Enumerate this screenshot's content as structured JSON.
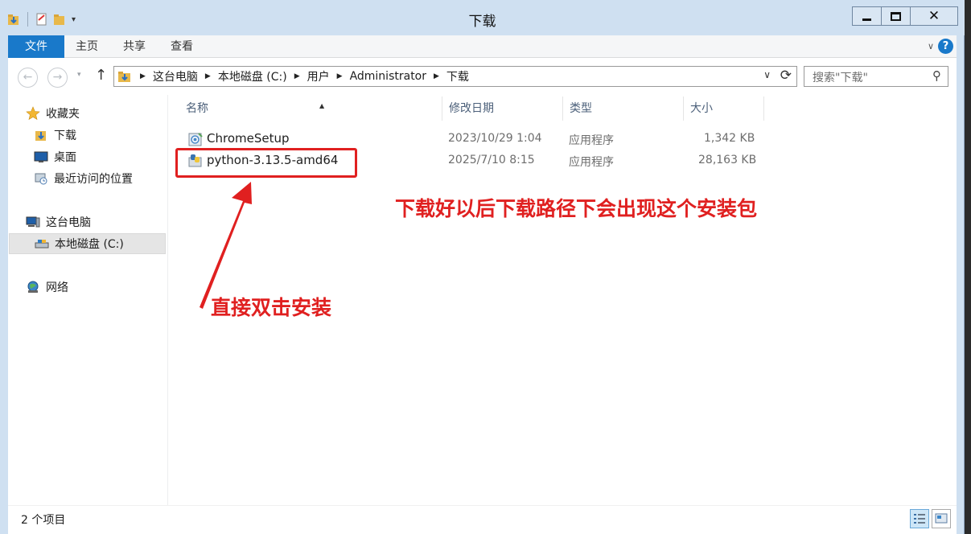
{
  "window": {
    "title": "下载",
    "minimize_icon": "minimize-icon",
    "maximize_icon": "maximize-icon",
    "close_label": "✕"
  },
  "ribbon": {
    "tabs": [
      "文件",
      "主页",
      "共享",
      "查看"
    ],
    "expand_glyph": "∨",
    "help_label": "?",
    "accent": "#1979ca"
  },
  "nav": {
    "back_glyph": "←",
    "forward_glyph": "→",
    "recent_glyph": "▾",
    "up_glyph": "↑",
    "breadcrumb": [
      "这台电脑",
      "本地磁盘 (C:)",
      "用户",
      "Administrator",
      "下载"
    ],
    "dropdown_glyph": "∨",
    "refresh_glyph": "⟳",
    "search_placeholder": "搜索\"下载\"",
    "search_icon": "⚲"
  },
  "sidebar": {
    "items": [
      {
        "label": "收藏夹",
        "icon": "star-icon"
      },
      {
        "label": "下载",
        "icon": "download-folder-icon"
      },
      {
        "label": "桌面",
        "icon": "desktop-icon"
      },
      {
        "label": "最近访问的位置",
        "icon": "recent-places-icon"
      },
      {
        "label": "这台电脑",
        "icon": "computer-icon"
      },
      {
        "label": "本地磁盘 (C:)",
        "icon": "drive-icon"
      },
      {
        "label": "网络",
        "icon": "network-icon"
      }
    ]
  },
  "columns": [
    "名称",
    "修改日期",
    "类型",
    "大小"
  ],
  "sort_glyph": "▲",
  "files": [
    {
      "name": "ChromeSetup",
      "date": "2023/10/29 1:04",
      "type": "应用程序",
      "size": "1,342 KB",
      "icon": "chrome-setup-icon"
    },
    {
      "name": "python-3.13.5-amd64",
      "date": "2025/7/10 8:15",
      "type": "应用程序",
      "size": "28,163 KB",
      "icon": "python-installer-icon"
    }
  ],
  "annotations": {
    "note_path": "下载好以后下载路径下会出现这个安装包",
    "note_install": "直接双击安装",
    "color": "#e02020"
  },
  "status": {
    "item_count": "2 个项目"
  }
}
